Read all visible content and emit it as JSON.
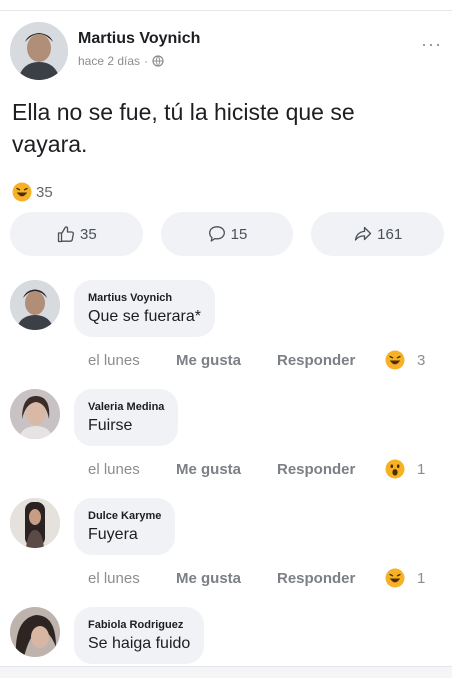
{
  "post": {
    "author": "Martius Voynich",
    "timestamp": "hace 2 días",
    "separator": "·",
    "privacy_icon": "globe-icon",
    "more_icon": "···",
    "text": "Ella no se fue, tú la hiciste que se vayara.",
    "reaction_count": "35",
    "actions": {
      "like": "35",
      "comment": "15",
      "share": "161"
    }
  },
  "comments": [
    {
      "author": "Martius Voynich",
      "text": "Que se fuerara*",
      "time": "el lunes",
      "like": "Me gusta",
      "reply": "Responder",
      "reaction": "haha",
      "reaction_count": "3"
    },
    {
      "author": "Valeria Medina",
      "text": "Fuirse",
      "time": "el lunes",
      "like": "Me gusta",
      "reply": "Responder",
      "reaction": "wow",
      "reaction_count": "1"
    },
    {
      "author": "Dulce Karyme",
      "text": "Fuyera",
      "time": "el lunes",
      "like": "Me gusta",
      "reply": "Responder",
      "reaction": "haha",
      "reaction_count": "1"
    },
    {
      "author": "Fabiola Rodriguez",
      "text": "Se haiga fuido"
    }
  ],
  "colors": {
    "text": "#1c1e21",
    "secondary": "#8a8d91",
    "bubble": "#f0f2f5",
    "reaction_yellow": "#f7b125"
  }
}
